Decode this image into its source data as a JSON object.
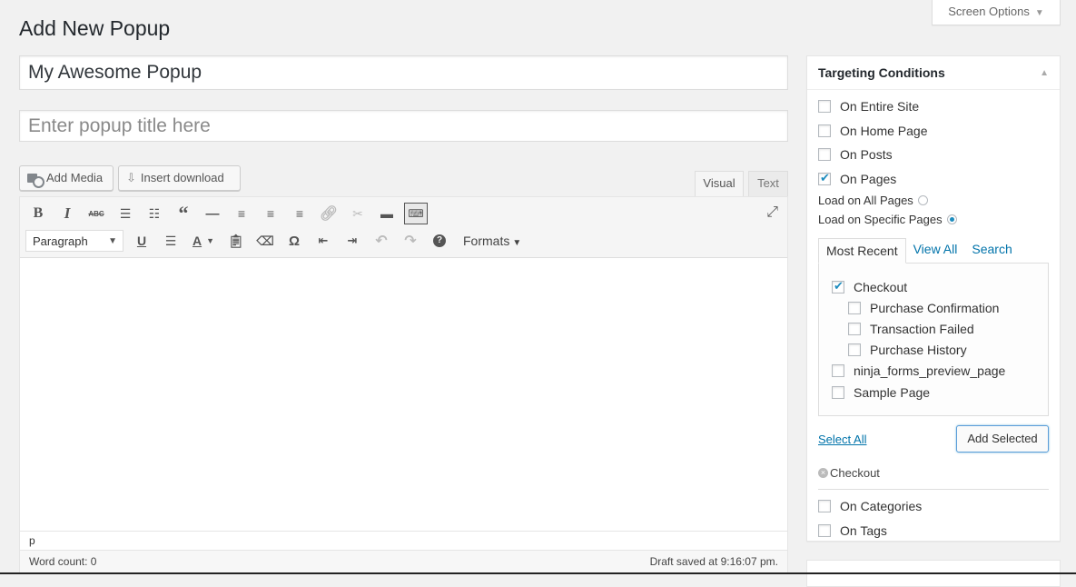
{
  "screen_options": {
    "label": "Screen Options"
  },
  "page_title": "Add New Popup",
  "title_field_1": {
    "value": "My Awesome Popup",
    "placeholder": ""
  },
  "title_field_2": {
    "value": "",
    "placeholder": "Enter popup title here"
  },
  "media_buttons": {
    "add_media": "Add Media",
    "insert_download": "Insert download"
  },
  "editor_tabs": {
    "visual": "Visual",
    "text": "Text",
    "active": "visual"
  },
  "toolbar": {
    "row1": [
      "bold-icon",
      "italic-icon",
      "strikethrough-icon",
      "bullet-list-icon",
      "numbered-list-icon",
      "blockquote-icon",
      "horizontal-line-icon",
      "align-left-icon",
      "align-center-icon",
      "align-right-icon",
      "insert-link-icon",
      "unlink-icon",
      "read-more-icon",
      "toolbar-toggle-icon"
    ],
    "format_select": "Paragraph",
    "formats_label": "Formats"
  },
  "editor": {
    "path": "p",
    "word_count": "Word count: 0",
    "draft_saved": "Draft saved at 9:16:07 pm."
  },
  "targeting": {
    "title": "Targeting Conditions",
    "conditions": [
      {
        "label": "On Entire Site",
        "checked": false
      },
      {
        "label": "On Home Page",
        "checked": false
      },
      {
        "label": "On Posts",
        "checked": false
      },
      {
        "label": "On Pages",
        "checked": true
      }
    ],
    "load_all_label": "Load on All Pages",
    "load_specific_label": "Load on Specific Pages",
    "load_mode": "specific",
    "tabs": [
      "Most Recent",
      "View All",
      "Search"
    ],
    "active_tab": "Most Recent",
    "pages": [
      {
        "label": "Checkout",
        "checked": true,
        "child": false
      },
      {
        "label": "Purchase Confirmation",
        "checked": false,
        "child": true
      },
      {
        "label": "Transaction Failed",
        "checked": false,
        "child": true
      },
      {
        "label": "Purchase History",
        "checked": false,
        "child": true
      },
      {
        "label": "ninja_forms_preview_page",
        "checked": false,
        "child": false
      },
      {
        "label": "Sample Page",
        "checked": false,
        "child": false
      }
    ],
    "select_all": "Select All",
    "add_selected": "Add Selected",
    "selected_items": [
      "Checkout"
    ],
    "more_conditions": [
      {
        "label": "On Categories",
        "checked": false
      },
      {
        "label": "On Tags",
        "checked": false
      }
    ]
  }
}
